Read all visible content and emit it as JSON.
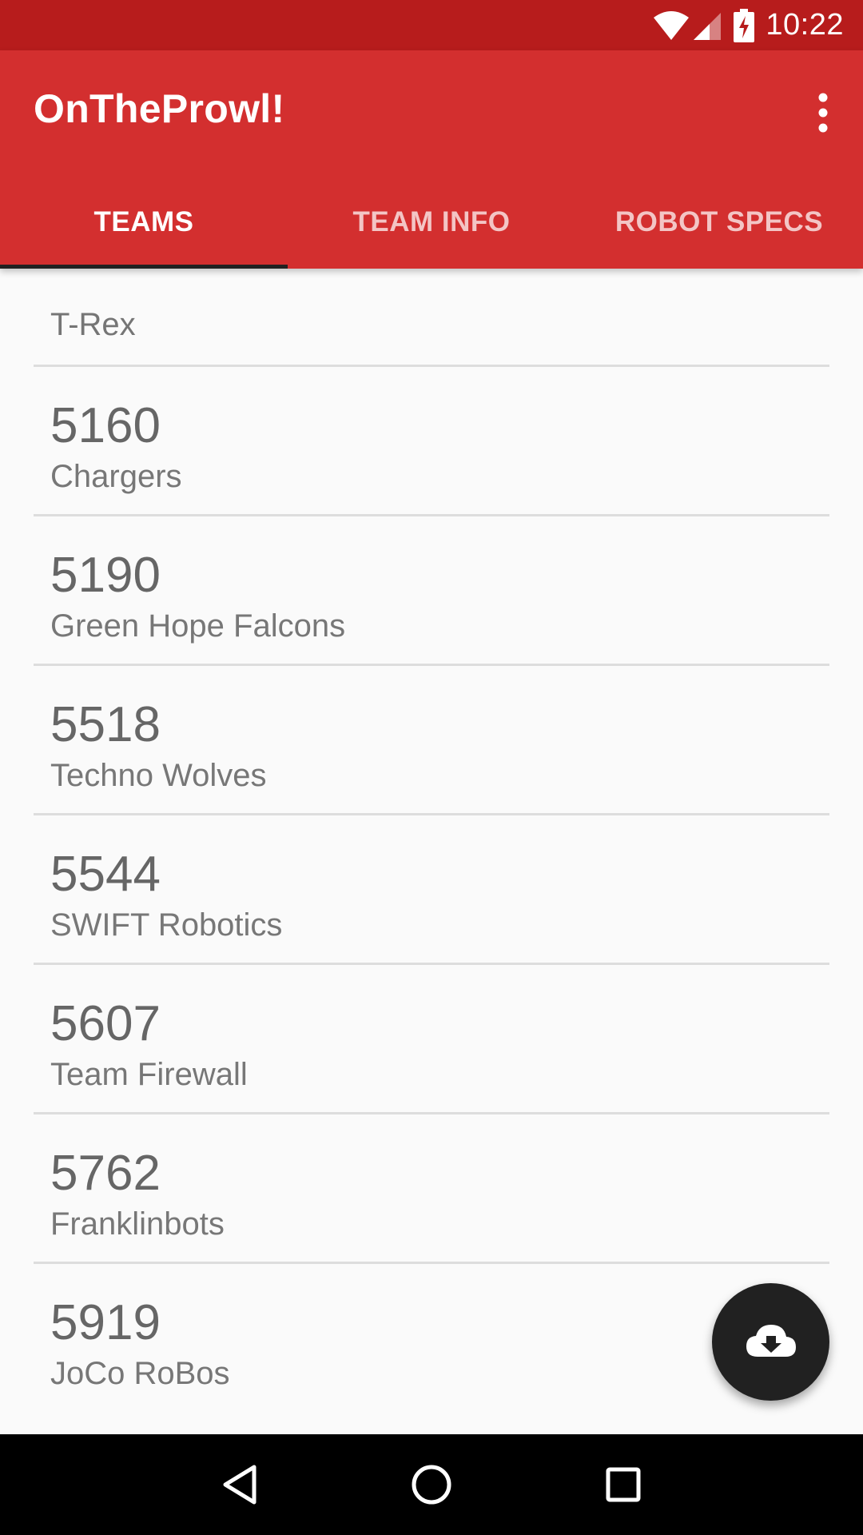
{
  "status_bar": {
    "time": "10:22",
    "icons": [
      "wifi-icon",
      "cell-signal-icon",
      "battery-charging-icon"
    ]
  },
  "app_bar": {
    "title": "OnTheProwl!",
    "menu_icon": "more-vert-icon"
  },
  "tabs": [
    {
      "label": "TEAMS",
      "active": true
    },
    {
      "label": "TEAM INFO",
      "active": false
    },
    {
      "label": "ROBOT SPECS",
      "active": false
    }
  ],
  "list": {
    "header": "T-Rex",
    "teams": [
      {
        "number": "5160",
        "name": "Chargers"
      },
      {
        "number": "5190",
        "name": "Green Hope Falcons"
      },
      {
        "number": "5518",
        "name": "Techno Wolves"
      },
      {
        "number": "5544",
        "name": "SWIFT Robotics"
      },
      {
        "number": "5607",
        "name": "Team Firewall"
      },
      {
        "number": "5762",
        "name": "Franklinbots"
      },
      {
        "number": "5919",
        "name": "JoCo RoBos"
      }
    ]
  },
  "fab": {
    "icon": "cloud-download-icon"
  },
  "nav_bar": {
    "icons": [
      "back-icon",
      "home-icon",
      "recents-icon"
    ]
  },
  "colors": {
    "status_bar": "#b71c1c",
    "app_bar": "#d32f2f",
    "tab_indicator": "#212121",
    "fab": "#212121",
    "background": "#fafafa"
  }
}
